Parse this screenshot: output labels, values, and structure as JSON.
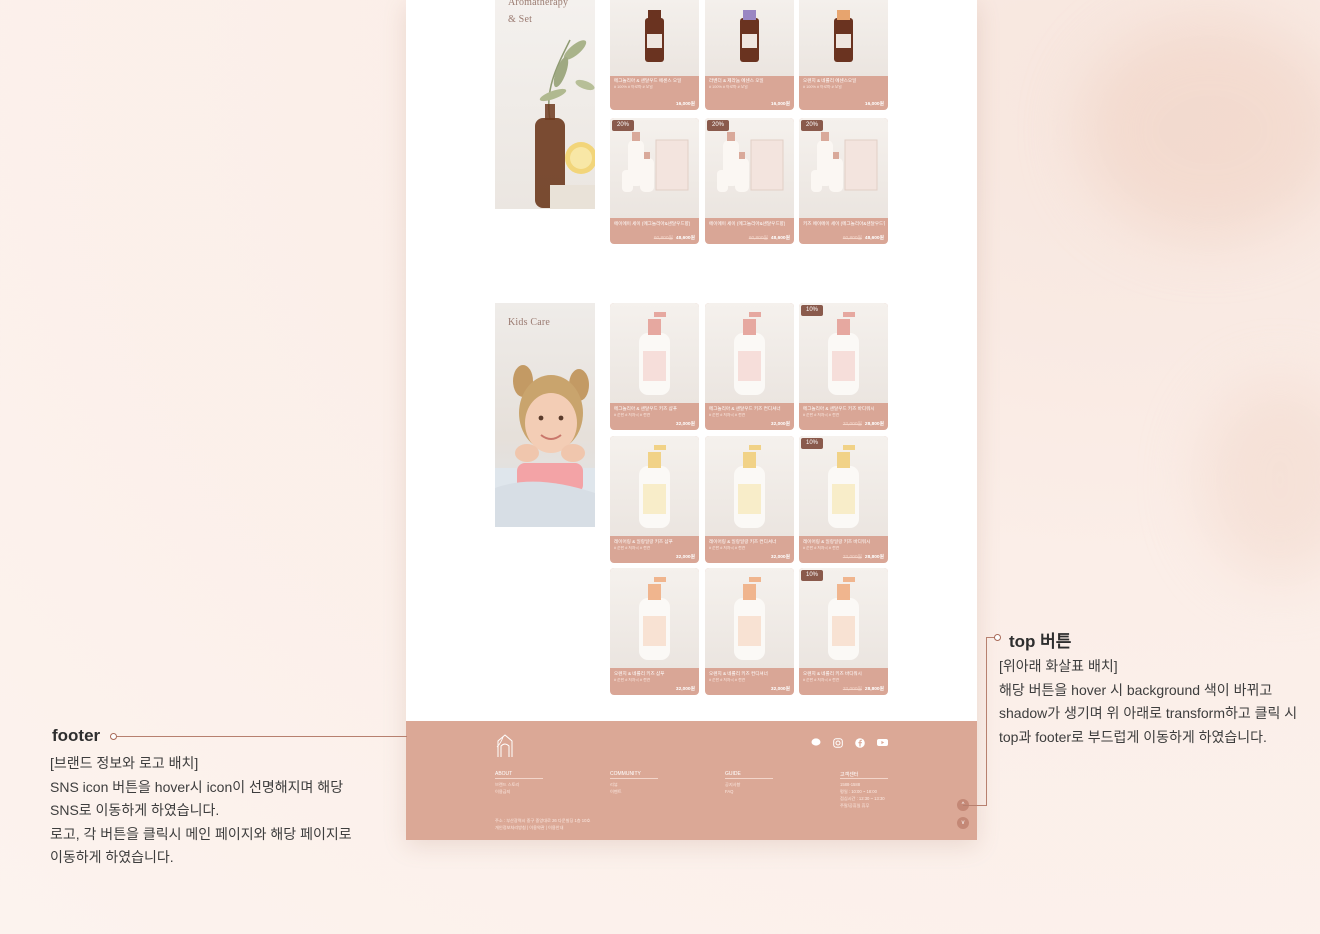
{
  "banners": {
    "aroma_title": "Aromatherapy",
    "aroma_sub": "& Set",
    "kids_title": "Kids Care"
  },
  "aroma_products": [
    {
      "name": "메그놀리아 & 샌달우드 에센스 오일",
      "tags": "# 100% # 아로마 # 오일",
      "price": "16,000원",
      "old": "",
      "badge": ""
    },
    {
      "name": "라벤더 & 제라늄 에센스 오일",
      "tags": "# 100% # 아로마 # 오일",
      "price": "16,000원",
      "old": "",
      "badge": ""
    },
    {
      "name": "오렌지 & 네롤리 에센스오일",
      "tags": "# 100% # 아로마 # 오일",
      "price": "16,000원",
      "old": "",
      "badge": ""
    },
    {
      "name": "에이에이 세이 (메그놀리아&샌달우드향)",
      "tags": "",
      "price": "48,600원",
      "old": "60,800원",
      "badge": "20%"
    },
    {
      "name": "에이에이 세이 (메그놀리아&샌달우드향)",
      "tags": "",
      "price": "48,600원",
      "old": "60,800원",
      "badge": "20%"
    },
    {
      "name": "키즈 에이에이 세이 (메그놀리아&샌달우드향)",
      "tags": "",
      "price": "48,600원",
      "old": "60,800원",
      "badge": "20%"
    }
  ],
  "kids_products": [
    {
      "name": "메그놀리아 & 샌달우드 키즈 샴푸",
      "tags": "# 순한 # 저자극 # 천연",
      "price": "32,000원",
      "old": "",
      "badge": ""
    },
    {
      "name": "메그놀리아 & 샌달우드 키즈 컨디셔너",
      "tags": "# 순한 # 저자극 # 천연",
      "price": "32,000원",
      "old": "",
      "badge": ""
    },
    {
      "name": "메그놀리아 & 샌달우드 키즈 바디워시",
      "tags": "# 순한 # 저자극 # 천연",
      "price": "28,800원",
      "old": "32,000원",
      "badge": "10%"
    },
    {
      "name": "레이어링 & 일랑일랑 키즈 샴푸",
      "tags": "# 순한 # 저자극 # 천연",
      "price": "32,000원",
      "old": "",
      "badge": ""
    },
    {
      "name": "레이어링 & 일랑일랑 키즈 컨디셔너",
      "tags": "# 순한 # 저자극 # 천연",
      "price": "32,000원",
      "old": "",
      "badge": ""
    },
    {
      "name": "레이어링 & 일랑일랑 키즈 바디워시",
      "tags": "# 순한 # 저자극 # 천연",
      "price": "28,800원",
      "old": "32,000원",
      "badge": "10%"
    },
    {
      "name": "오렌지 & 네롤리 키즈 샴푸",
      "tags": "# 순한 # 저자극 # 천연",
      "price": "32,000원",
      "old": "",
      "badge": ""
    },
    {
      "name": "오렌지 & 네롤리 키즈 컨디셔너",
      "tags": "# 순한 # 저자극 # 천연",
      "price": "32,000원",
      "old": "",
      "badge": ""
    },
    {
      "name": "오렌지 & 네롤리 키즈 바디워시",
      "tags": "# 순한 # 저자극 # 천연",
      "price": "28,800원",
      "old": "32,000원",
      "badge": "10%"
    }
  ],
  "footer": {
    "about_head": "ABOUT",
    "about_links": [
      "브랜드 스토리",
      "이용금지"
    ],
    "community_head": "COMMUNITY",
    "community_links": [
      "리뷰",
      "이벤트"
    ],
    "guide_head": "GUIDE",
    "guide_links": [
      "공지사항",
      "FAQ"
    ],
    "cs_head": "고객센터",
    "cs_lines": [
      "1588-1588",
      "평일 : 10:00 ~ 18:00",
      "점심시간 : 12:30 ~ 13:30",
      "주말/공휴일 휴무"
    ],
    "address": "주소 : 부산광역시 중구 중앙대로 26 다운빌딩 1층 10호",
    "policy": "개인정보처리방침 | 이용약관 | 이용안내",
    "top_arrow": "^",
    "down_arrow": "v"
  },
  "annotations": {
    "footer_title": "footer",
    "footer_lines": [
      "[브랜드 정보와 로고 배치]",
      "SNS icon 버튼을 hover시 icon이 선명해지며 해당",
      "SNS로 이동하게 하였습니다.",
      "로고, 각 버튼을  클릭시 메인 페이지와 해당 페이지로",
      "이동하게 하였습니다."
    ],
    "top_title": "top 버튼",
    "top_lines": [
      "[위아래 화살표 배치]",
      "해당 버튼을 hover 시 background 색이 바뀌고",
      "shadow가 생기며 위 아래로 transform하고 클릭 시",
      "top과 footer로 부드럽게 이동하게 하였습니다."
    ]
  },
  "colors": {
    "accent": "#dba896",
    "card": "#d9a696",
    "badge": "#8a5a4c"
  }
}
